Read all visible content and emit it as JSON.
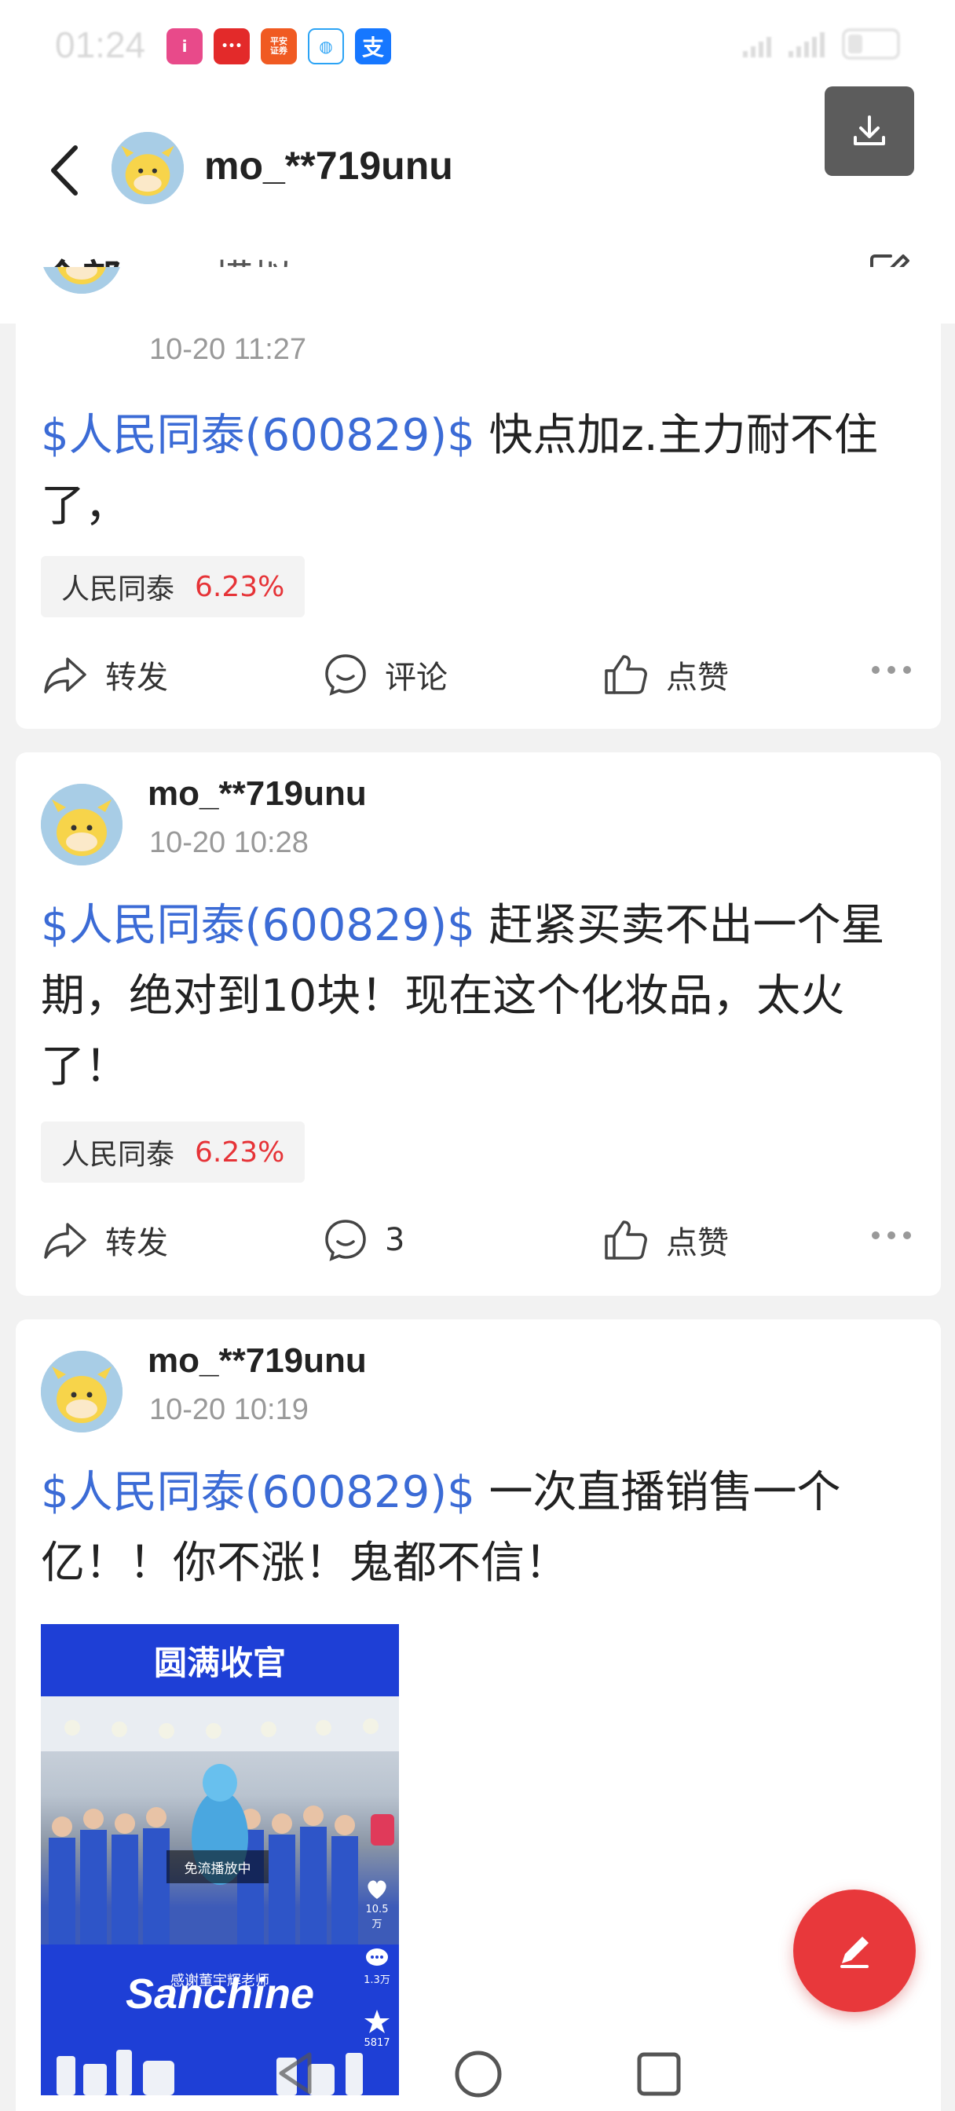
{
  "status_bar": {
    "time": "01:24",
    "app_icons": [
      {
        "icon": "app-icon-pink",
        "label": "i",
        "color": "#e84a8a"
      },
      {
        "icon": "app-icon-red",
        "label": "•••",
        "color": "#e32a2a"
      },
      {
        "icon": "app-icon-pingan",
        "label": "平安\n证券",
        "color": "#f05a22"
      },
      {
        "icon": "app-icon-chat",
        "label": "◍",
        "color": "#2ba3f5"
      },
      {
        "icon": "app-icon-alipay",
        "label": "支",
        "color": "#1677ff"
      }
    ]
  },
  "header": {
    "username": "mo_**719unu",
    "tabs": [
      {
        "label": "全部",
        "active": true
      },
      {
        "label": "模拟",
        "active": false
      }
    ]
  },
  "posts": [
    {
      "username": "",
      "time": "10-20 11:27",
      "stock_tag": "$人民同泰(600829)$",
      "text": " 快点加z.主力耐不住了，",
      "chip": {
        "name": "人民同泰",
        "pct": "6.23%"
      },
      "actions": {
        "forward": "转发",
        "comment": "评论",
        "like": "点赞"
      }
    },
    {
      "username": "mo_**719unu",
      "time": "10-20 10:28",
      "stock_tag": "$人民同泰(600829)$",
      "text": " 赶紧买卖不出一个星期，绝对到10块！现在这个化妆品，太火了！",
      "chip": {
        "name": "人民同泰",
        "pct": "6.23%"
      },
      "actions": {
        "forward": "转发",
        "comment": "3",
        "like": "点赞"
      }
    },
    {
      "username": "mo_**719unu",
      "time": "10-20 10:19",
      "stock_tag": "$人民同泰(600829)$",
      "text": " 一次直播销售一个亿！！你不涨！鬼都不信！",
      "image": {
        "title": "圆满收官",
        "overlay": "免流播放中",
        "caption": "感谢董宇辉老师",
        "brand": "Sanchine",
        "likes": "10.5万",
        "comments": "1.3万",
        "stars": "5817"
      }
    }
  ],
  "colors": {
    "accent": "#e63337",
    "stock_link": "#3b6bd6",
    "fab": "#e8383b"
  }
}
